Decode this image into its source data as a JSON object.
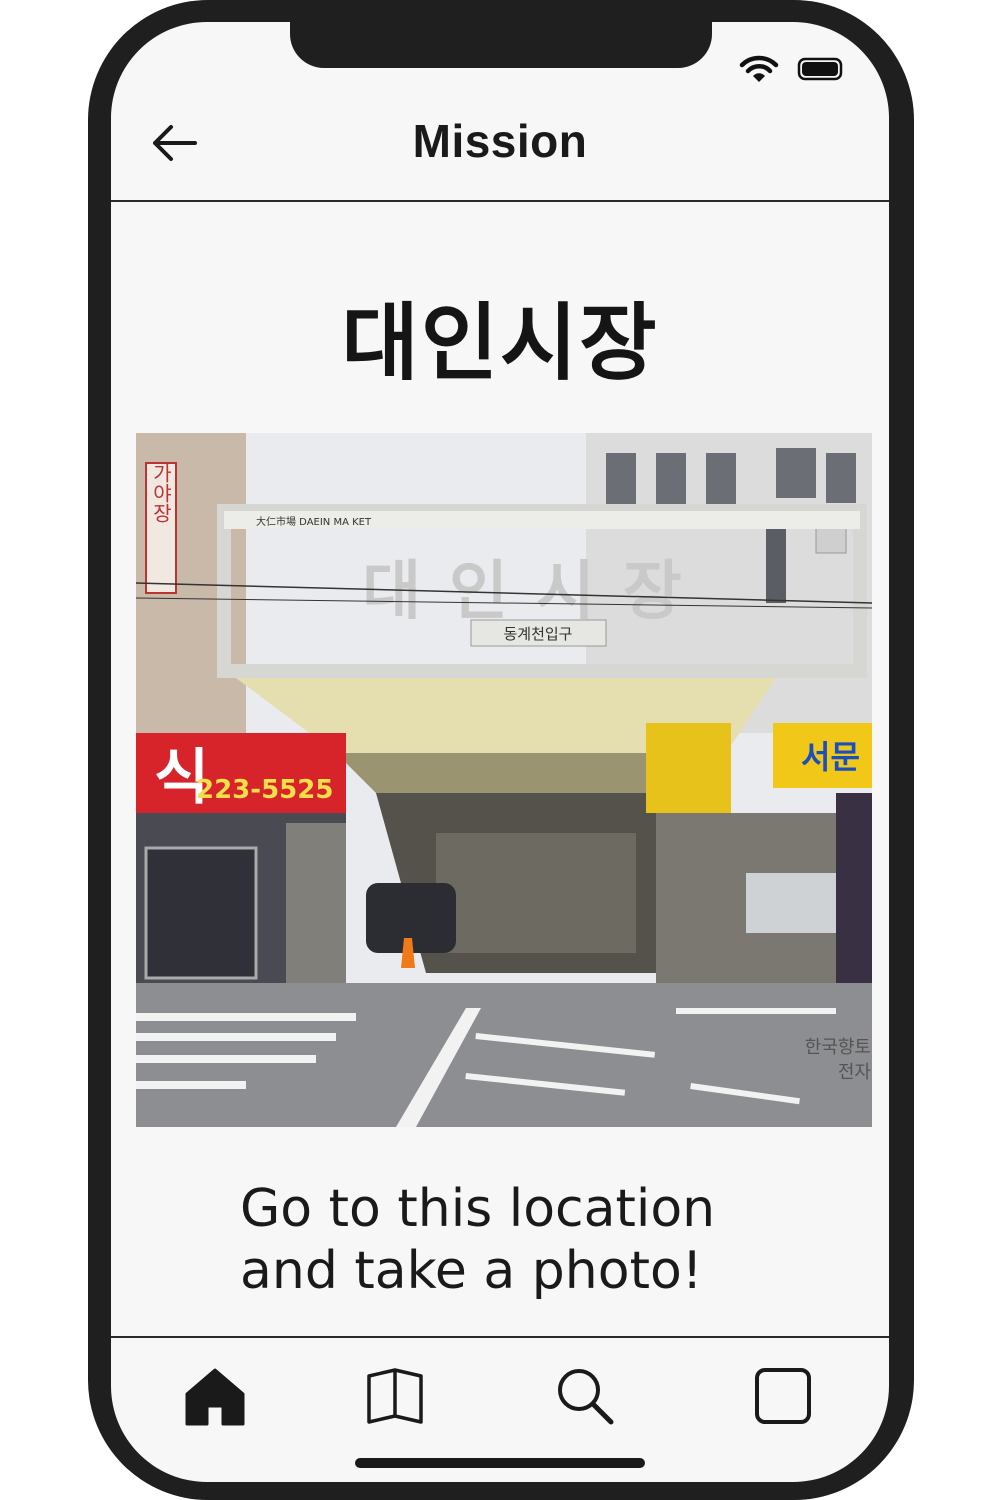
{
  "header": {
    "title": "Mission",
    "back_icon": "arrow-left-icon"
  },
  "status_bar": {
    "icons": [
      "wifi-icon",
      "battery-icon"
    ]
  },
  "mission": {
    "location_name": "대인시장",
    "photo": {
      "sign_small_text": "大仁市場 DAEIN MA KET",
      "sign_large_text": "대인시장",
      "entrance_label": "동계천입구",
      "left_shop_text": "식",
      "left_shop_phone": "223-5525",
      "left_vertical_sign": "가야장",
      "right_shop_text": "서문",
      "watermark_line1": "한국향토",
      "watermark_line2": "전자"
    },
    "instruction_line1": "Go to this location",
    "instruction_line2": "and take a photo!"
  },
  "tabbar": {
    "tabs": [
      {
        "name": "home",
        "icon": "home-icon"
      },
      {
        "name": "book",
        "icon": "book-icon"
      },
      {
        "name": "search",
        "icon": "search-icon"
      },
      {
        "name": "square",
        "icon": "square-icon"
      }
    ]
  },
  "colors": {
    "frame": "#1f1f1f",
    "screen": "#f7f7f7",
    "text": "#1a1a1a"
  }
}
